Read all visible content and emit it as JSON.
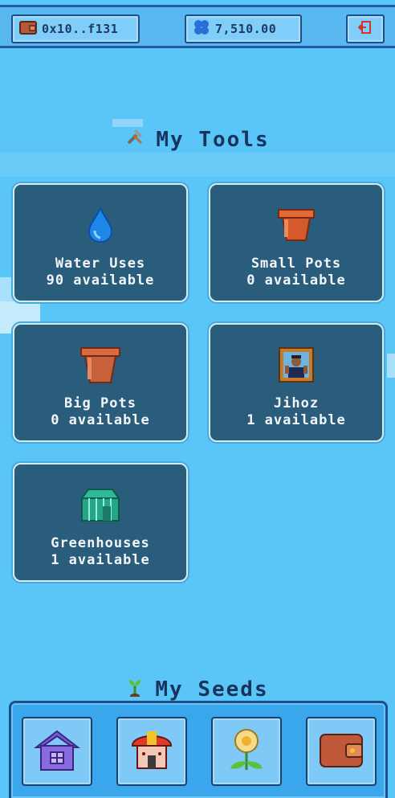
{
  "header": {
    "wallet_address": "0x10..f131",
    "balance": "7,510.00",
    "icons": {
      "wallet": "wallet-icon",
      "balance": "clover-icon",
      "logout": "logout-icon"
    }
  },
  "tools_section": {
    "title": "My Tools",
    "icon": "tools-icon",
    "items": [
      {
        "name": "Water Uses",
        "count": "90 available",
        "icon": "water-drop-icon"
      },
      {
        "name": "Small Pots",
        "count": "0 available",
        "icon": "small-pot-icon"
      },
      {
        "name": "Big Pots",
        "count": "0 available",
        "icon": "big-pot-icon"
      },
      {
        "name": "Jihoz",
        "count": "1 available",
        "icon": "jihoz-portrait-icon"
      },
      {
        "name": "Greenhouses",
        "count": "1 available",
        "icon": "greenhouse-icon"
      }
    ]
  },
  "seeds_section": {
    "title": "My Seeds",
    "icon": "sprout-icon"
  },
  "bottom_nav": {
    "items": [
      {
        "icon": "house-icon"
      },
      {
        "icon": "shop-icon"
      },
      {
        "icon": "flower-icon"
      },
      {
        "icon": "wallet-icon"
      }
    ]
  },
  "colors": {
    "sky": "#5ac6f8",
    "card": "#2a5d7c",
    "title": "#17335e"
  }
}
